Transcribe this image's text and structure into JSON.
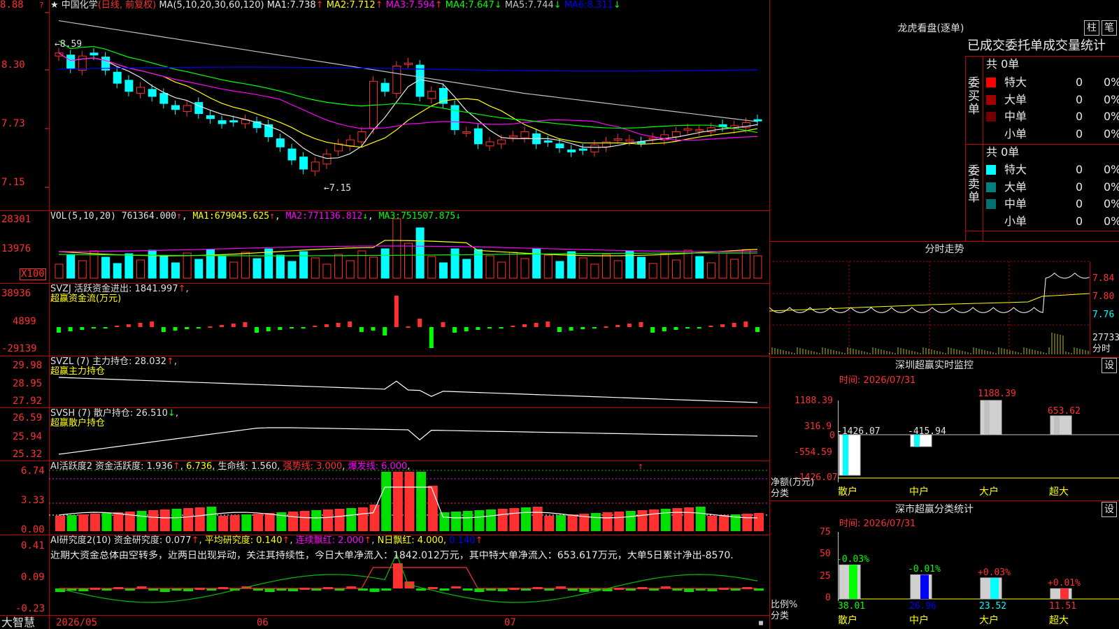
{
  "header": {
    "star": "★",
    "stock_name": "中国化学",
    "period": "(日线, 前复权)",
    "ma_formula": "MA(5,10,20,30,60,120)",
    "ma": [
      {
        "label": "MA1:",
        "value": "7.738",
        "arrow": "↑",
        "color": "#e8e8e8"
      },
      {
        "label": "MA2:",
        "value": "7.712",
        "arrow": "↑",
        "color": "#ffff00"
      },
      {
        "label": "MA3:",
        "value": "7.594",
        "arrow": "↑",
        "color": "#ff00ff"
      },
      {
        "label": "MA4:",
        "value": "7.647",
        "arrow": "↓",
        "color": "#00ff00"
      },
      {
        "label": "MA5:",
        "value": "7.744",
        "arrow": "↓",
        "color": "#c0c0c0"
      },
      {
        "label": "MA6:",
        "value": "8.311",
        "arrow": "↓",
        "color": "#0000ff"
      }
    ]
  },
  "price_axis": [
    "8.88",
    "8.30",
    "7.73",
    "7.15"
  ],
  "annotations": {
    "high": "←8.59",
    "low": "←7.15",
    "tick_mark": "↑"
  },
  "vol": {
    "title": "VOL(5,10,20)",
    "value": "761364.000",
    "ma1_label": "MA1:",
    "ma1": "679045.625",
    "ma2_label": "MA2:",
    "ma2": "771136.812",
    "ma3_label": "MA3:",
    "ma3": "751507.875",
    "axis": [
      "28301",
      "13976"
    ],
    "unit": "X100",
    "arrows": [
      "↑",
      "↑",
      "↓",
      "↓"
    ]
  },
  "svzj": {
    "title": "SVZJ",
    "label": "活跃资金进出:",
    "value": "1841.997",
    "arrow": "↑",
    "sub": "超赢资金流(万元)",
    "axis": [
      "38936",
      "4899",
      "-29139"
    ]
  },
  "svzl": {
    "title": "SVZL (7)",
    "label": "主力持仓:",
    "value": "28.032",
    "arrow": "↑",
    "sub": "超赢主力持仓",
    "axis": [
      "29.98",
      "28.95",
      "27.92"
    ]
  },
  "svsh": {
    "title": "SVSH (7)",
    "label": "散户持仓:",
    "value": "26.510",
    "arrow": "↓",
    "sub": "超赢散户持仓",
    "axis": [
      "26.59",
      "25.94",
      "25.32"
    ]
  },
  "ai2": {
    "title": "AI活跃度2",
    "label": "资金活跃度:",
    "value": "1.936",
    "arrow": "↑",
    "v2": "6.736",
    "life_label": "生命线:",
    "life": "1.560",
    "strong": "强势线: 3.000",
    "burst": "爆发线: 6.000",
    "axis": [
      "6.74",
      "3.33",
      "0.00"
    ]
  },
  "ai_research": {
    "title": "AI研究度2(10)",
    "label": "资金研究度:",
    "value": "0.077",
    "arrow": "↑",
    "avg": "平均研究度: 0.140",
    "cont": "连续飘红: 2.000",
    "nday": "N日飘红: 4.000,",
    "tail": "0.140",
    "text": "近期大资金总体由空转多，近两日出现异动，关注其持续性，今日大单净流入：1842.012万元，其中特大单净流入：653.617万元，大单5日累计净出-8570.",
    "axis": [
      "0.41",
      "0.09",
      "-0.23"
    ]
  },
  "bottom": {
    "brand": "大智慧",
    "dates": [
      "2026/05",
      "06",
      "07"
    ]
  },
  "lhb": {
    "title": "龙虎看盘(逐单)",
    "btn_bar": "柱",
    "btn_pen": "笔",
    "sub": "已成交委托单成交量统计",
    "buy_label": "委买单",
    "sell_label": "委卖单",
    "buy_total": "共 0单",
    "sell_total": "共 0单",
    "buy_rows": [
      {
        "name": "特大",
        "n": "0",
        "p": "0%",
        "c": "#ff0000"
      },
      {
        "name": "大单",
        "n": "0",
        "p": "0%",
        "c": "#a00000"
      },
      {
        "name": "中单",
        "n": "0",
        "p": "0%",
        "c": "#700000"
      },
      {
        "name": "小单",
        "n": "0",
        "p": "0%",
        "c": "#000000"
      }
    ],
    "sell_rows": [
      {
        "name": "特大",
        "n": "0",
        "p": "0%",
        "c": "#00ffff"
      },
      {
        "name": "大单",
        "n": "0",
        "p": "0%",
        "c": "#008080"
      },
      {
        "name": "中单",
        "n": "0",
        "p": "0%",
        "c": "#007070"
      },
      {
        "name": "小单",
        "n": "0",
        "p": "0%",
        "c": "#000000"
      }
    ]
  },
  "fenshi": {
    "title": "分时走势",
    "axis": [
      "7.84",
      "7.80",
      "7.76"
    ],
    "vol_label": "27733",
    "unit": "分时"
  },
  "monitor": {
    "title": "深圳超赢实时监控",
    "btn": "设",
    "time": "时间: 2026/07/31",
    "axis": [
      "1188.39",
      "316.9",
      "0",
      "-554.59",
      "-1426.07"
    ],
    "net_label": "净额(万元)",
    "cat_label": "分类",
    "values": [
      {
        "name": "散户",
        "v": "-1426.07"
      },
      {
        "name": "中户",
        "v": "-415.94"
      },
      {
        "name": "大户",
        "v": "1188.39"
      },
      {
        "name": "超大",
        "v": "653.62"
      }
    ]
  },
  "stats": {
    "title": "深市超赢分类统计",
    "btn": "设",
    "time": "时间: 2026/07/31",
    "axis": [
      "75",
      "50",
      "25",
      "0"
    ],
    "ratio_label": "比例%",
    "cat_label": "分类",
    "values": [
      {
        "name": "散户",
        "pct": "38.01",
        "chg": "-0.03%"
      },
      {
        "name": "中户",
        "pct": "26.96",
        "chg": "-0.01%"
      },
      {
        "name": "大户",
        "pct": "23.52",
        "chg": "+0.03%"
      },
      {
        "name": "超大",
        "pct": "11.51",
        "chg": "+0.01%"
      }
    ]
  },
  "colors": {
    "up": "#ff3030",
    "down": "#00ffff",
    "grid": "#b00000",
    "yellow": "#ffff00"
  }
}
